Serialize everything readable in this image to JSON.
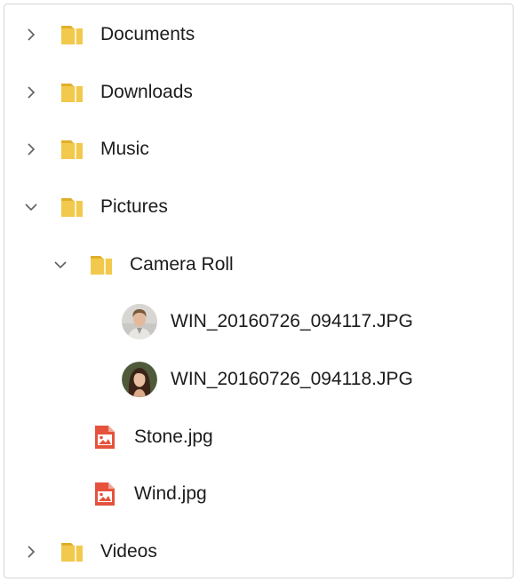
{
  "tree": {
    "nodes": [
      {
        "label": "Documents",
        "icon": "folder-icon",
        "expanded": false
      },
      {
        "label": "Downloads",
        "icon": "folder-icon",
        "expanded": false
      },
      {
        "label": "Music",
        "icon": "folder-icon",
        "expanded": false
      },
      {
        "label": "Pictures",
        "icon": "folder-icon",
        "expanded": true
      },
      {
        "label": "Camera Roll",
        "icon": "folder-icon",
        "expanded": true
      },
      {
        "label": "WIN_20160726_094117.JPG",
        "icon": "man-avatar-thumbnail"
      },
      {
        "label": "WIN_20160726_094118.JPG",
        "icon": "woman-avatar-thumbnail"
      },
      {
        "label": "Stone.jpg",
        "icon": "image-file-icon"
      },
      {
        "label": "Wind.jpg",
        "icon": "image-file-icon"
      },
      {
        "label": "Videos",
        "icon": "folder-icon",
        "expanded": false
      }
    ]
  },
  "colors": {
    "folder": "#f2c94c",
    "folder_dark": "#e0af2a",
    "image_file": "#e5533d",
    "chevron": "#5f5f5f",
    "text": "#1c1c1c",
    "border": "#d6d6d6"
  }
}
